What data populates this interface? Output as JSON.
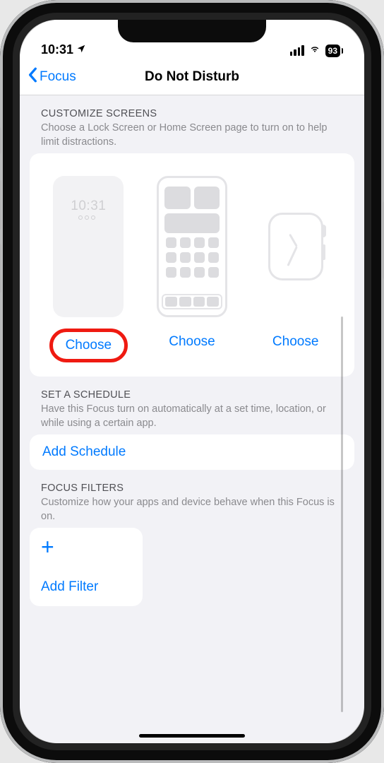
{
  "status": {
    "time": "10:31",
    "battery": "93"
  },
  "nav": {
    "back": "Focus",
    "title": "Do Not Disturb"
  },
  "customize": {
    "title": "CUSTOMIZE SCREENS",
    "sub": "Choose a Lock Screen or Home Screen page to turn on to help limit distractions.",
    "lock_preview_time": "10:31",
    "choose1": "Choose",
    "choose2": "Choose",
    "choose3": "Choose"
  },
  "schedule": {
    "title": "SET A SCHEDULE",
    "sub": "Have this Focus turn on automatically at a set time, location, or while using a certain app.",
    "add": "Add Schedule"
  },
  "filters": {
    "title": "FOCUS FILTERS",
    "sub": "Customize how your apps and device behave when this Focus is on.",
    "add": "Add Filter"
  }
}
